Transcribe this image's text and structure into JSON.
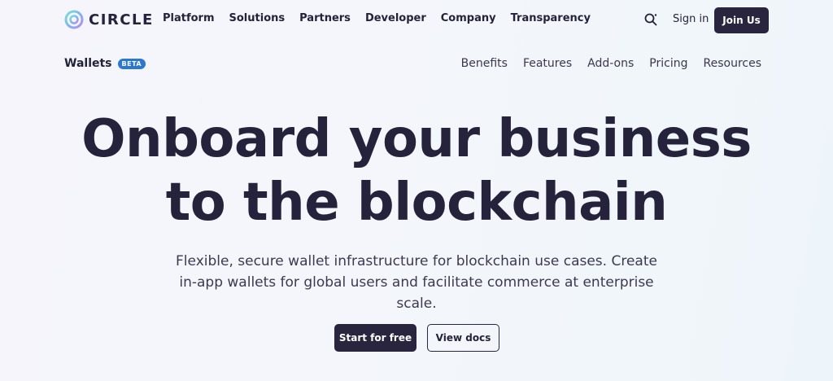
{
  "brand": {
    "name": "CIRCLE"
  },
  "main_nav": {
    "items": [
      {
        "label": "Platform"
      },
      {
        "label": "Solutions"
      },
      {
        "label": "Partners"
      },
      {
        "label": "Developer"
      },
      {
        "label": "Company"
      },
      {
        "label": "Transparency"
      }
    ]
  },
  "header_actions": {
    "search_icon": "search-icon",
    "signin_label": "Sign in",
    "join_label": "Join Us"
  },
  "product_bar": {
    "name": "Wallets",
    "badge": "BETA",
    "links": [
      {
        "label": "Benefits"
      },
      {
        "label": "Features"
      },
      {
        "label": "Add-ons"
      },
      {
        "label": "Pricing"
      },
      {
        "label": "Resources"
      }
    ]
  },
  "hero": {
    "title_line1": "Onboard your business",
    "title_line2": "to the blockchain",
    "subtitle": "Flexible, secure wallet infrastructure for blockchain use cases. Create in-app wallets for global users and facilitate commerce at enterprise scale.",
    "primary_cta": "Start for free",
    "secondary_cta": "View docs"
  },
  "colors": {
    "dark": "#29253f",
    "beta_badge": "#2b77d4"
  }
}
